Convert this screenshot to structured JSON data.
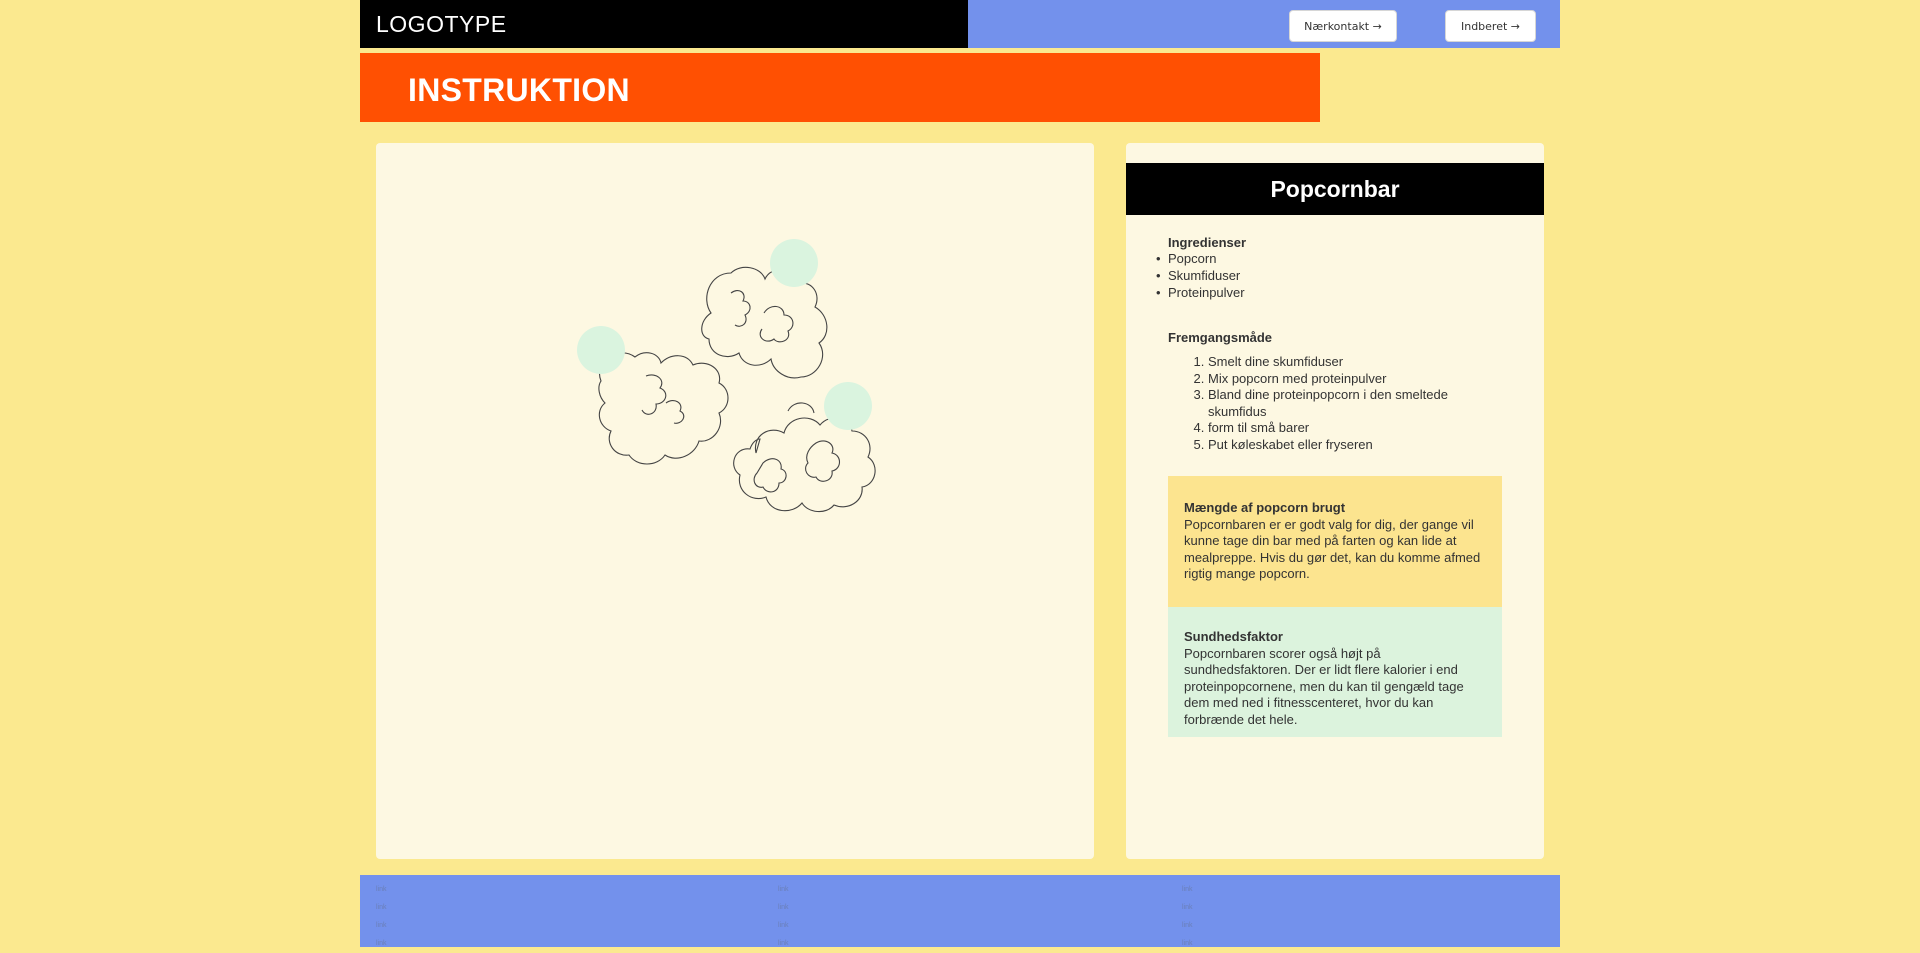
{
  "header": {
    "logo": "LOGOTYPE",
    "contact_button": "Nærkontakt →",
    "report_button": "Indberet →"
  },
  "banner": {
    "title": "INSTRUKTION"
  },
  "recipe": {
    "title": "Popcornbar",
    "ingredients_title": "Ingredienser",
    "ingredients": [
      "Popcorn",
      "Skumfiduser",
      "Proteinpulver"
    ],
    "method_title": "Fremgangsmåde",
    "steps": [
      "Smelt dine skumfiduser",
      "Mix popcorn med proteinpulver",
      "Bland dine proteinpopcorn i den smeltede skumfidus",
      "form til små barer",
      "Put køleskabet eller fryseren"
    ],
    "amount_box": {
      "title": "Mængde af popcorn brugt",
      "text": "Popcornbaren er er godt valg for dig, der gange vil kunne tage din bar med på farten og kan lide at mealpreppe. Hvis du gør det, kan du komme afmed rigtig mange popcorn."
    },
    "health_box": {
      "title": "Sundhedsfaktor",
      "text": "Popcornbaren scorer også højt på sundhedsfaktoren. Der er lidt flere kalorier i end proteinpopcornene, men du kan til gengæld tage dem med ned i fitnesscenteret, hvor du kan forbrænde det hele."
    }
  },
  "footer": {
    "col1": [
      "link",
      "link",
      "link",
      "link"
    ],
    "col2": [
      "link",
      "link",
      "link",
      "link"
    ],
    "col3": [
      "link",
      "link",
      "link",
      "link"
    ]
  },
  "colors": {
    "background": "#fbe98f",
    "header_blue": "#7391ec",
    "banner_orange": "#ff5002",
    "panel": "#fdf8e2",
    "amount_box": "#fce48f",
    "health_box": "#dcf3dd",
    "mint_circle": "#daf4df"
  },
  "image": {
    "icon": "popcorn-illustration"
  }
}
